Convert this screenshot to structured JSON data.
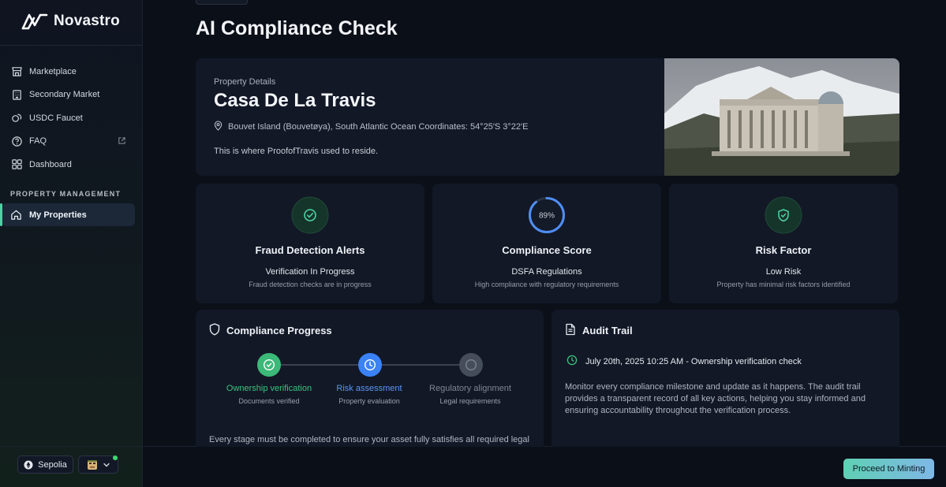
{
  "app": {
    "name": "Novastro"
  },
  "sidebar": {
    "items": [
      {
        "label": "Marketplace",
        "icon": "store-icon"
      },
      {
        "label": "Secondary Market",
        "icon": "building-icon"
      },
      {
        "label": "USDC Faucet",
        "icon": "coins-icon"
      },
      {
        "label": "FAQ",
        "icon": "help-circle-icon",
        "external": true
      },
      {
        "label": "Dashboard",
        "icon": "grid-icon"
      }
    ],
    "section_label": "PROPERTY MANAGEMENT",
    "active_item": {
      "label": "My Properties",
      "icon": "home-icon"
    },
    "network": "Sepolia"
  },
  "page": {
    "title": "AI Compliance Check"
  },
  "property": {
    "label": "Property Details",
    "name": "Casa De La Travis",
    "location": "Bouvet Island (Bouvetøya), South Atlantic Ocean Coordinates: 54°25′S 3°22′E",
    "description": "This is where ProofofTravis used to reside."
  },
  "stats": {
    "fraud": {
      "title": "Fraud Detection Alerts",
      "status": "Verification In Progress",
      "desc": "Fraud detection checks are in progress"
    },
    "compliance": {
      "title": "Compliance Score",
      "score_label": "89%",
      "score": 0.89,
      "status": "DSFA Regulations",
      "desc": "High compliance with regulatory requirements"
    },
    "risk": {
      "title": "Risk Factor",
      "status": "Low Risk",
      "desc": "Property has minimal risk factors identified"
    }
  },
  "progress": {
    "title": "Compliance Progress",
    "steps": [
      {
        "label": "Ownership verification",
        "desc": "Documents verified",
        "state": "done"
      },
      {
        "label": "Risk assessment",
        "desc": "Property evaluation",
        "state": "active"
      },
      {
        "label": "Regulatory alignment",
        "desc": "Legal requirements",
        "state": "pending"
      }
    ],
    "note": "Every stage must be completed to ensure your asset fully satisfies all required legal and regulatory standards prior to successful tokenization."
  },
  "audit": {
    "title": "Audit Trail",
    "entry": "July 20th, 2025 10:25 AM - Ownership verification check",
    "desc": "Monitor every compliance milestone and update as it happens. The audit trail provides a transparent record of all key actions, helping you stay informed and ensuring accountability throughout the verification process."
  },
  "actions": {
    "mint_label": "Proceed to Minting"
  },
  "colors": {
    "accent_green": "#4fd1a6",
    "accent_blue": "#3b82f6",
    "done_green": "#3cb878"
  }
}
